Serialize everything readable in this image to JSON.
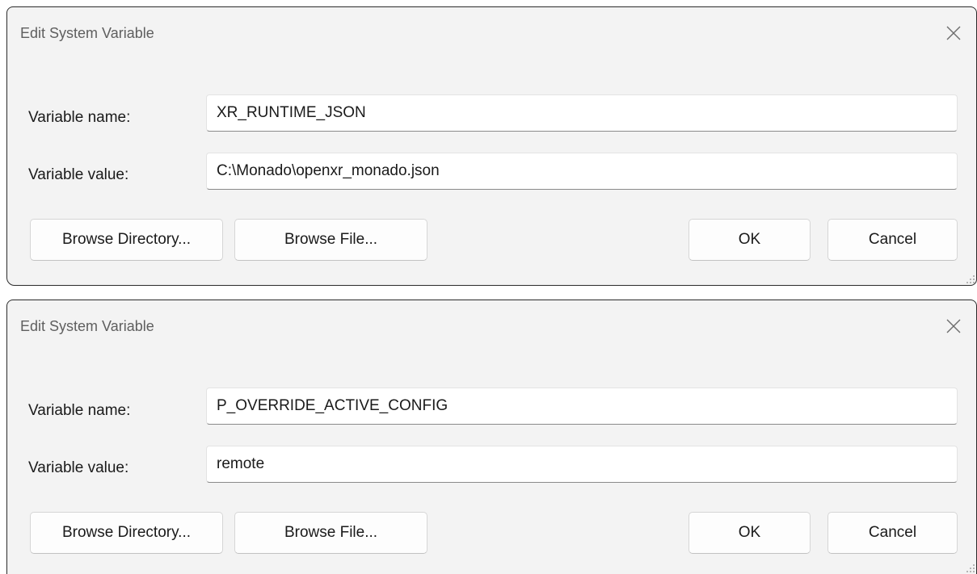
{
  "dialogs": [
    {
      "title": "Edit System Variable",
      "name_label": "Variable name:",
      "name_value": "XR_RUNTIME_JSON",
      "value_label": "Variable value:",
      "value_value": "C:\\Monado\\openxr_monado.json",
      "browse_directory": "Browse Directory...",
      "browse_file": "Browse File...",
      "ok": "OK",
      "cancel": "Cancel"
    },
    {
      "title": "Edit System Variable",
      "name_label": "Variable name:",
      "name_value": "P_OVERRIDE_ACTIVE_CONFIG",
      "value_label": "Variable value:",
      "value_value": "remote",
      "browse_directory": "Browse Directory...",
      "browse_file": "Browse File...",
      "ok": "OK",
      "cancel": "Cancel"
    }
  ],
  "colors": {
    "dialog_bg": "#f3f3f3",
    "field_bg": "#ffffff",
    "button_bg": "#fdfdfd",
    "title_text": "#5f5f5f",
    "text": "#1a1a1a"
  }
}
